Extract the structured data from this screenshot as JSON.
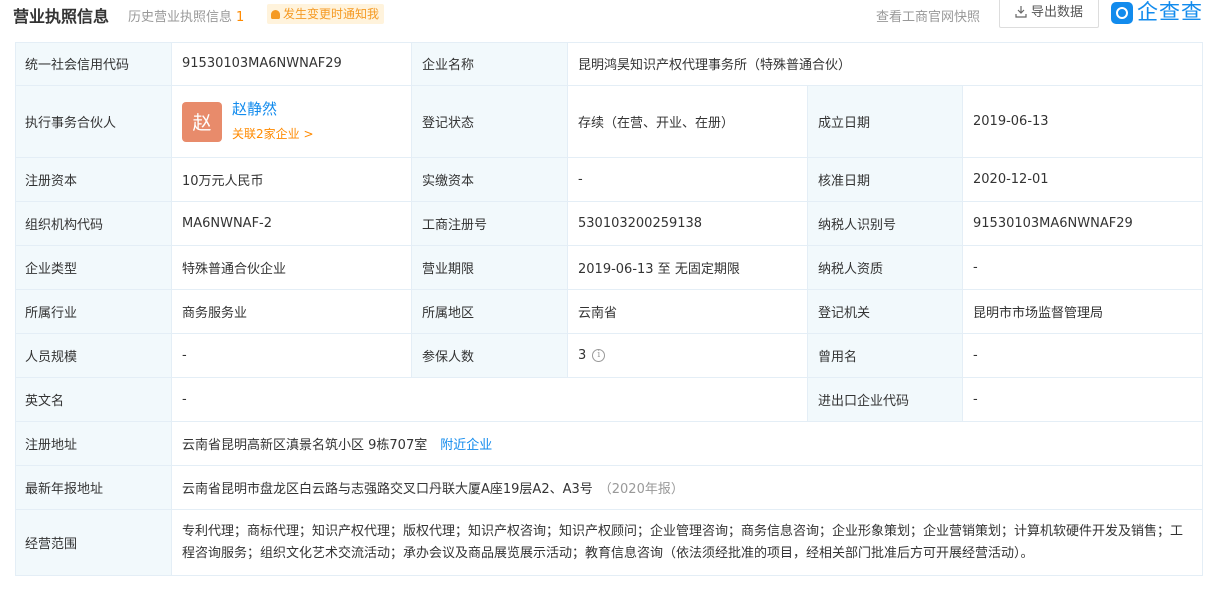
{
  "header": {
    "title": "营业执照信息",
    "history_label": "历史营业执照信息",
    "history_count": "1",
    "notify_label": "发生变更时通知我",
    "snapshot_label": "查看工商官网快照",
    "export_label": "导出数据",
    "logo_text": "企查查"
  },
  "fields": {
    "credit_code": {
      "label": "统一社会信用代码",
      "value": "91530103MA6NWNAF29"
    },
    "company_name": {
      "label": "企业名称",
      "value": "昆明鸿昊知识产权代理事务所（特殊普通合伙）"
    },
    "partner": {
      "label": "执行事务合伙人",
      "avatar": "赵",
      "name": "赵静然",
      "related": "关联2家企业 >"
    },
    "reg_status": {
      "label": "登记状态",
      "value": "存续（在营、开业、在册）"
    },
    "found_date": {
      "label": "成立日期",
      "value": "2019-06-13"
    },
    "reg_capital": {
      "label": "注册资本",
      "value": "10万元人民币"
    },
    "paid_capital": {
      "label": "实缴资本",
      "value": "-"
    },
    "approve_date": {
      "label": "核准日期",
      "value": "2020-12-01"
    },
    "org_code": {
      "label": "组织机构代码",
      "value": "MA6NWNAF-2"
    },
    "biz_reg_no": {
      "label": "工商注册号",
      "value": "530103200259138"
    },
    "taxpayer_id": {
      "label": "纳税人识别号",
      "value": "91530103MA6NWNAF29"
    },
    "company_type": {
      "label": "企业类型",
      "value": "特殊普通合伙企业"
    },
    "biz_term": {
      "label": "营业期限",
      "value": "2019-06-13 至 无固定期限"
    },
    "taxpayer_quality": {
      "label": "纳税人资质",
      "value": "-"
    },
    "industry": {
      "label": "所属行业",
      "value": "商务服务业"
    },
    "region": {
      "label": "所属地区",
      "value": "云南省"
    },
    "reg_authority": {
      "label": "登记机关",
      "value": "昆明市市场监督管理局"
    },
    "staff_size": {
      "label": "人员规模",
      "value": "-"
    },
    "insured": {
      "label": "参保人数",
      "value": "3"
    },
    "former_name": {
      "label": "曾用名",
      "value": "-"
    },
    "english_name": {
      "label": "英文名",
      "value": "-"
    },
    "import_export": {
      "label": "进出口企业代码",
      "value": "-"
    },
    "reg_address": {
      "label": "注册地址",
      "value": "云南省昆明高新区滇景名筑小区 9栋707室",
      "link": "附近企业"
    },
    "report_address": {
      "label": "最新年报地址",
      "value": "云南省昆明市盘龙区白云路与志强路交叉口丹联大厦A座19层A2、A3号",
      "note": "（2020年报）"
    },
    "scope": {
      "label": "经营范围",
      "value": "专利代理；商标代理；知识产权代理；版权代理；知识产权咨询；知识产权顾问；企业管理咨询；商务信息咨询；企业形象策划；企业营销策划；计算机软硬件开发及销售；工程咨询服务；组织文化艺术交流活动；承办会议及商品展览展示活动；教育信息咨询（依法须经批准的项目，经相关部门批准后方可开展经营活动）。"
    }
  },
  "icons": {
    "bell": "bell-icon",
    "download": "download-icon",
    "info": "info-icon",
    "logo": "qichacha-logo"
  },
  "colors": {
    "accent": "#128bed",
    "orange": "#ff8a00",
    "label_bg": "#f2f9fc",
    "border": "#e4eef6",
    "avatar_bg": "#e88b6b"
  }
}
